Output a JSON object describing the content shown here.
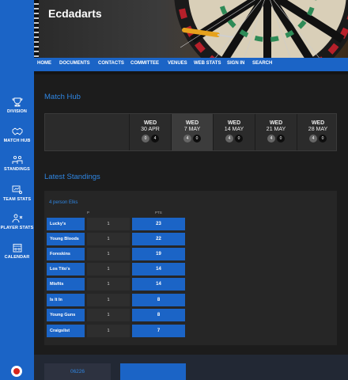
{
  "app": {
    "title": "Ecdadarts"
  },
  "sidebar": {
    "items": [
      {
        "label": "DIVISION",
        "icon": "trophy-icon"
      },
      {
        "label": "MATCH HUB",
        "icon": "handshake-icon"
      },
      {
        "label": "STANDINGS",
        "icon": "standings-icon"
      },
      {
        "label": "TEAM STATS",
        "icon": "team-stats-icon"
      },
      {
        "label": "PLAYER STATS",
        "icon": "player-stats-icon"
      },
      {
        "label": "CALENDAR",
        "icon": "calendar-icon"
      }
    ]
  },
  "nav": {
    "items": [
      "HOME",
      "DOCUMENTS",
      "CONTACTS",
      "COMMITTEE",
      "VENUES",
      "WEB STATS",
      "SIGN IN",
      "SEARCH"
    ]
  },
  "match_hub": {
    "title": "Match Hub",
    "days": [
      {
        "dow": "WED",
        "date": "30 APR",
        "home": "0",
        "away": "4",
        "active": false
      },
      {
        "dow": "WED",
        "date": "7 MAY",
        "home": "4",
        "away": "0",
        "active": true
      },
      {
        "dow": "WED",
        "date": "14 MAY",
        "home": "4",
        "away": "0",
        "active": false
      },
      {
        "dow": "WED",
        "date": "21 MAY",
        "home": "4",
        "away": "0",
        "active": false
      },
      {
        "dow": "WED",
        "date": "28 MAY",
        "home": "4",
        "away": "0",
        "active": false
      }
    ]
  },
  "standings": {
    "title": "Latest Standings",
    "division": "4 person Elks",
    "columns": {
      "played": "P",
      "points": "PTS"
    },
    "rows": [
      {
        "team": "Lucky's",
        "p": "1",
        "pts": "23"
      },
      {
        "team": "Young Bloods",
        "p": "1",
        "pts": "22"
      },
      {
        "team": "Foreskins",
        "p": "1",
        "pts": "19"
      },
      {
        "team": "Los Tito's",
        "p": "1",
        "pts": "14"
      },
      {
        "team": "Misfits",
        "p": "1",
        "pts": "14"
      },
      {
        "team": "Is It In",
        "p": "1",
        "pts": "8"
      },
      {
        "team": "Young Guns",
        "p": "1",
        "pts": "8"
      },
      {
        "team": "Craigslist",
        "p": "1",
        "pts": "7"
      }
    ]
  },
  "footer": {
    "button_label": "06226"
  },
  "colors": {
    "accent": "#1b64c6",
    "link": "#2f86e3",
    "background": "#1c1c1c"
  }
}
